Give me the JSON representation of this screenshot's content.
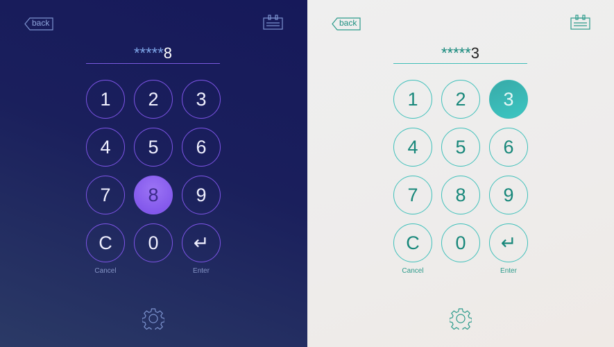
{
  "panels": [
    {
      "id": "dark",
      "theme": "dark",
      "back_label": "back",
      "pin_mask": "*****",
      "pin_last": "8",
      "active_key": "8",
      "keys": [
        "1",
        "2",
        "3",
        "4",
        "5",
        "6",
        "7",
        "8",
        "9",
        "C",
        "0",
        "↵"
      ],
      "cancel_label": "Cancel",
      "enter_label": "Enter",
      "accent": "#7f55e8",
      "icon_color": "#7d94d0"
    },
    {
      "id": "light",
      "theme": "light",
      "back_label": "back",
      "pin_mask": "*****",
      "pin_last": "3",
      "active_key": "3",
      "keys": [
        "1",
        "2",
        "3",
        "4",
        "5",
        "6",
        "7",
        "8",
        "9",
        "C",
        "0",
        "↵"
      ],
      "cancel_label": "Cancel",
      "enter_label": "Enter",
      "accent": "#3ec0ba",
      "icon_color": "#2a9a8a"
    }
  ]
}
